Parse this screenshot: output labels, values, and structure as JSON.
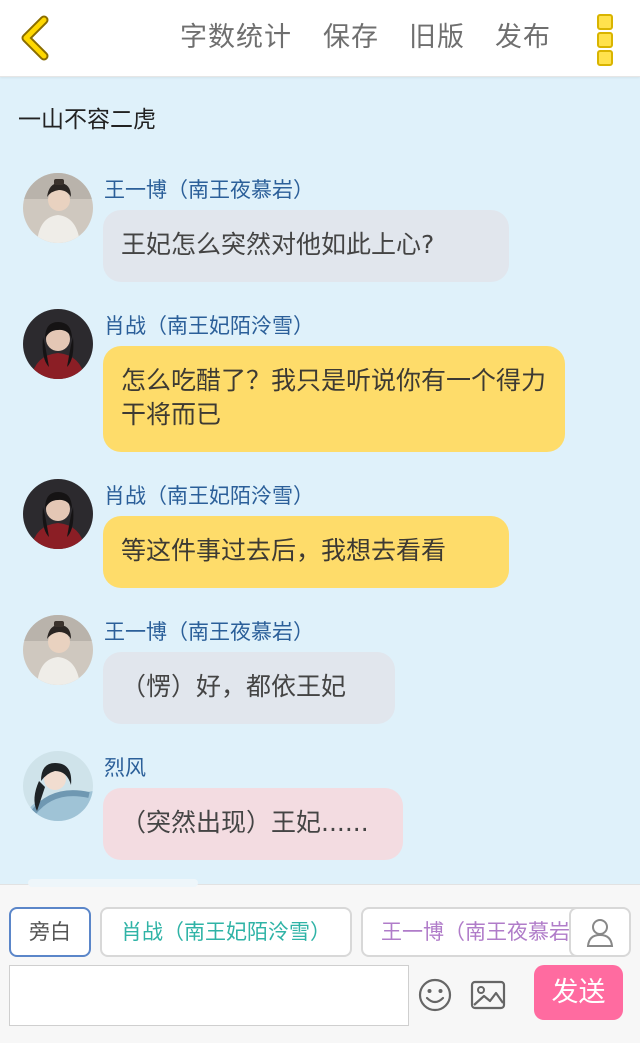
{
  "header": {
    "word_count_label": "字数统计",
    "save_label": "保存",
    "old_version_label": "旧版",
    "publish_label": "发布"
  },
  "story": {
    "title": "一山不容二虎"
  },
  "messages": [
    {
      "sender": "王一博（南王夜慕岩）",
      "text": "王妃怎么突然对他如此上心?",
      "style": "grey"
    },
    {
      "sender": "肖战（南王妃陌泠雪）",
      "text": "怎么吃醋了？我只是听说你有一个得力干将而已",
      "style": "yellow"
    },
    {
      "sender": "肖战（南王妃陌泠雪）",
      "text": "等这件事过去后，我想去看看",
      "style": "yellow"
    },
    {
      "sender": "王一博（南王夜慕岩）",
      "text": "（愣）好，都依王妃",
      "style": "grey"
    },
    {
      "sender": "烈风",
      "text": "（突然出现）王妃......",
      "style": "pink"
    }
  ],
  "composer": {
    "roles": [
      "旁白",
      "肖战（南王妃陌泠雪）",
      "王一博（南王夜慕岩"
    ],
    "input_value": "",
    "send_label": "发送"
  },
  "colors": {
    "accent_yellow": "#fedc6a",
    "bubble_grey": "#e1e6ed",
    "bubble_pink": "#f3dce1",
    "send_pink": "#ff6ba0",
    "sender_blue": "#2b5f99",
    "background": "#dff1fa"
  },
  "icons": [
    "back-chevron-icon",
    "more-dots-icon",
    "person-icon",
    "emoji-icon",
    "image-icon"
  ]
}
